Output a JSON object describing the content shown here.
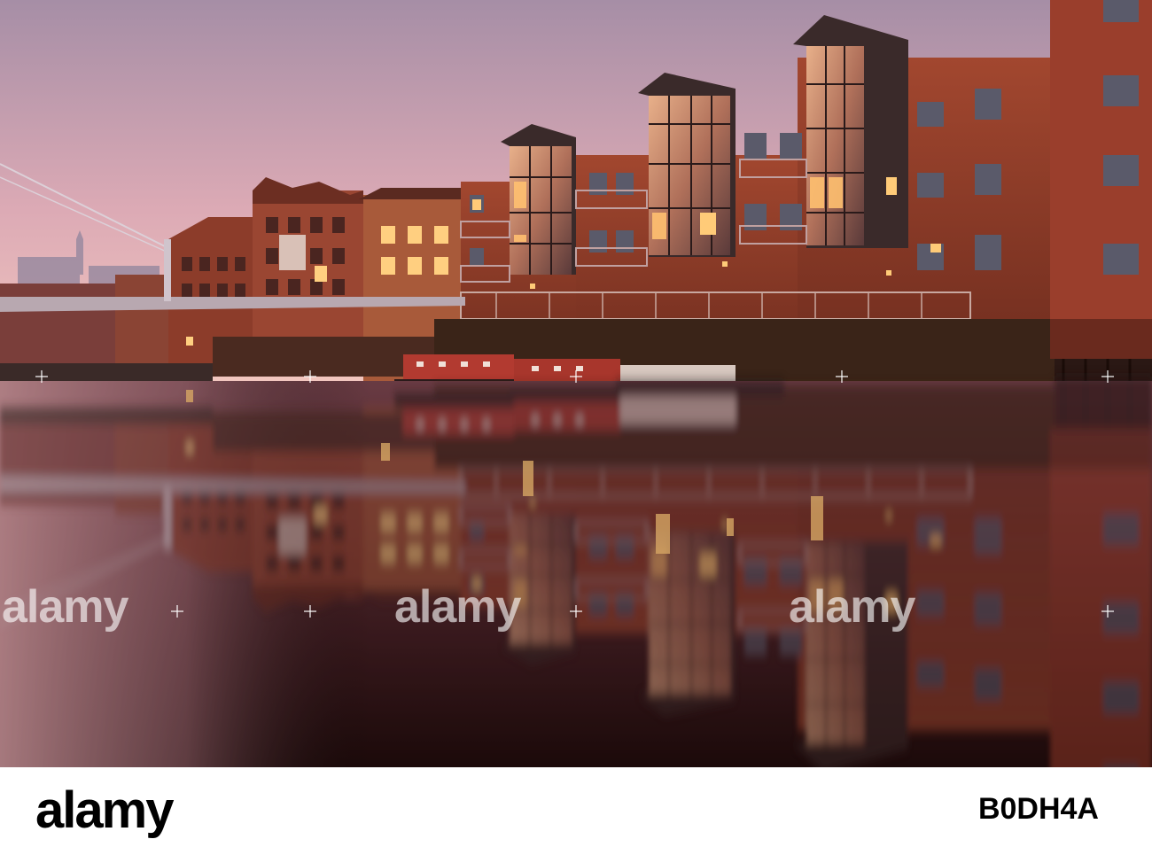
{
  "watermark": {
    "text": "alamy"
  },
  "footer": {
    "logo": "alamy",
    "image_id": "B0DH4A"
  },
  "colors": {
    "sky_top": "#a68ea6",
    "sky_bottom": "#f2c6bf",
    "water_dark": "#1c0a0a",
    "brick": "#8a3a28",
    "glow": "#ffb860",
    "boat_red": "#b23a30"
  }
}
